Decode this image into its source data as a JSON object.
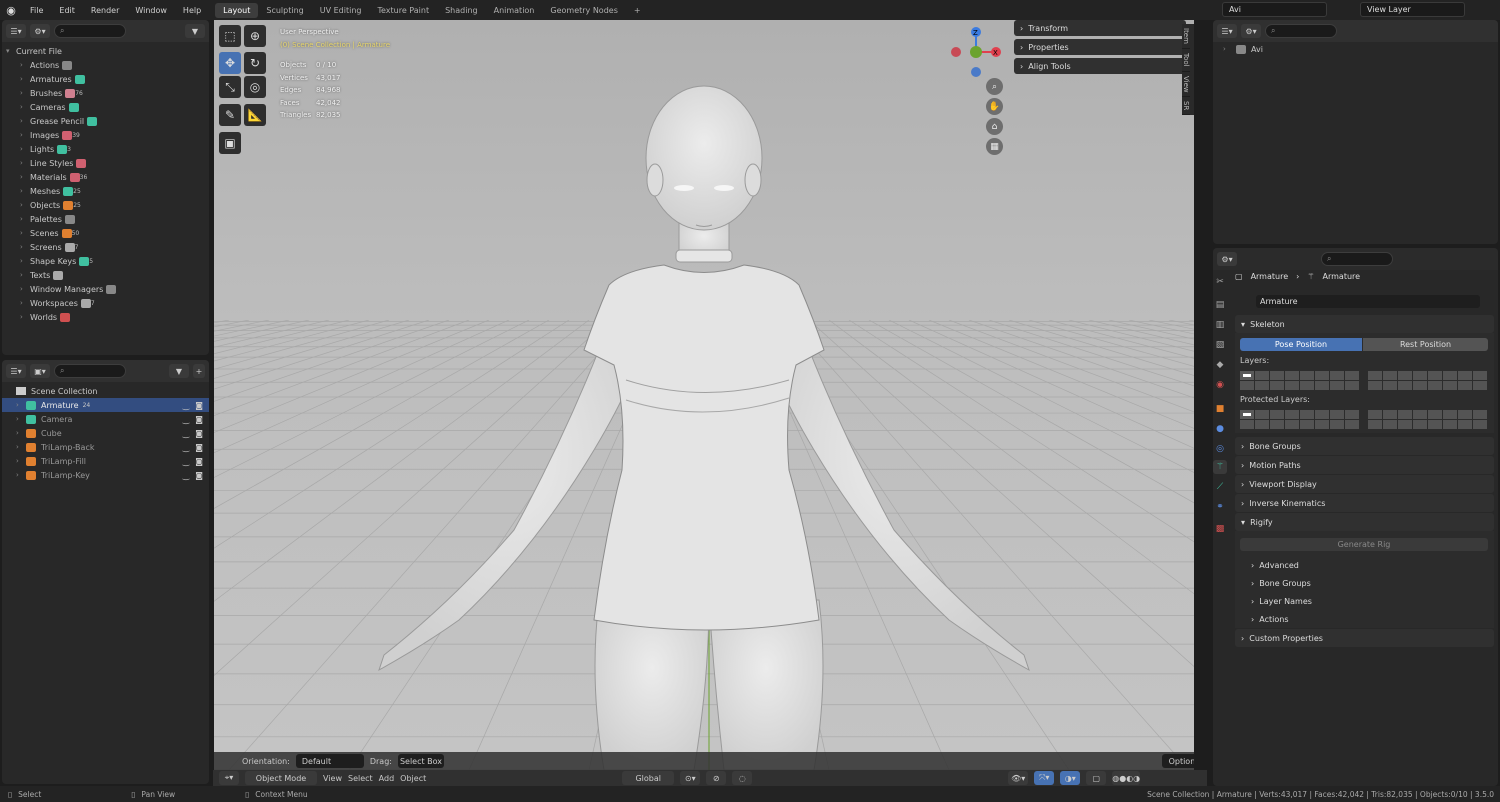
{
  "menu": [
    "File",
    "Edit",
    "Render",
    "Window",
    "Help"
  ],
  "workspaces": [
    "Layout",
    "Sculpting",
    "UV Editing",
    "Texture Paint",
    "Shading",
    "Animation",
    "Geometry Nodes",
    "+"
  ],
  "scene_name": "Avi",
  "view_layer": "View Layer",
  "datablocks": {
    "root": "Current File",
    "items": [
      {
        "label": "Actions",
        "count": ""
      },
      {
        "label": "Armatures",
        "count": ""
      },
      {
        "label": "Brushes",
        "count": "76"
      },
      {
        "label": "Cameras",
        "count": ""
      },
      {
        "label": "Grease Pencil",
        "count": ""
      },
      {
        "label": "Images",
        "count": "39"
      },
      {
        "label": "Lights",
        "count": "3"
      },
      {
        "label": "Line Styles",
        "count": ""
      },
      {
        "label": "Materials",
        "count": "36"
      },
      {
        "label": "Meshes",
        "count": "25"
      },
      {
        "label": "Objects",
        "count": "25"
      },
      {
        "label": "Palettes",
        "count": ""
      },
      {
        "label": "Scenes",
        "count": "50"
      },
      {
        "label": "Screens",
        "count": "7"
      },
      {
        "label": "Shape Keys",
        "count": "5"
      },
      {
        "label": "Texts",
        "count": ""
      },
      {
        "label": "Window Managers",
        "count": ""
      },
      {
        "label": "Workspaces",
        "count": "7"
      },
      {
        "label": "Worlds",
        "count": ""
      }
    ]
  },
  "outliner": {
    "collection": "Scene Collection",
    "items": [
      {
        "label": "Armature",
        "badge": "24",
        "selected": true
      },
      {
        "label": "Camera",
        "badge": "",
        "selected": false
      },
      {
        "label": "Cube",
        "badge": "",
        "selected": false
      },
      {
        "label": "TriLamp-Back",
        "badge": "",
        "selected": false
      },
      {
        "label": "TriLamp-Fill",
        "badge": "",
        "selected": false
      },
      {
        "label": "TriLamp-Key",
        "badge": "",
        "selected": false
      }
    ]
  },
  "scene_outliner": {
    "item": "Avi"
  },
  "viewport": {
    "perspective": "User Perspective",
    "collection_path": "(0) Scene Collection | Armature",
    "stats": [
      {
        "label": "Objects",
        "value": "0 / 10"
      },
      {
        "label": "Vertices",
        "value": "43,017"
      },
      {
        "label": "Edges",
        "value": "84,968"
      },
      {
        "label": "Faces",
        "value": "42,042"
      },
      {
        "label": "Triangles",
        "value": "82,035"
      }
    ],
    "npanel": [
      "Transform",
      "Properties",
      "Align Tools"
    ],
    "tabs": [
      "Item",
      "Tool",
      "View",
      "SR"
    ],
    "gizmo": {
      "x": "X",
      "z": "Z"
    }
  },
  "header": {
    "orientation_label": "Orientation:",
    "orientation_value": "Default",
    "drag_label": "Drag:",
    "drag_value": "Select Box",
    "options": "Options",
    "mode": "Object Mode",
    "view": "View",
    "select": "Select",
    "add": "Add",
    "object": "Object",
    "transform_orientation": "Global"
  },
  "properties": {
    "breadcrumb_object": "Armature",
    "breadcrumb_data": "Armature",
    "data_name": "Armature",
    "skeleton": "Skeleton",
    "pose_position": "Pose Position",
    "rest_position": "Rest Position",
    "layers": "Layers:",
    "protected_layers": "Protected Layers:",
    "sections": [
      "Bone Groups",
      "Motion Paths",
      "Viewport Display",
      "Inverse Kinematics"
    ],
    "rigify": "Rigify",
    "generate_rig": "Generate Rig",
    "rigify_subs": [
      "Advanced",
      "Bone Groups",
      "Layer Names",
      "Actions"
    ],
    "custom_properties": "Custom Properties"
  },
  "status_bar": {
    "select": "Select",
    "pan": "Pan View",
    "context": "Context Menu",
    "stats": "Scene Collection | Armature | Verts:43,017 | Faces:42,042 | Tris:82,035 | Objects:0/10 | 3.5.0"
  },
  "colors": {
    "accent": "#4772b3",
    "selected_row": "#334d80",
    "pose_btn": "#4772b3",
    "x_axis": "#e0404e",
    "y_axis": "#6ba32e",
    "z_axis": "#3b7be0"
  }
}
